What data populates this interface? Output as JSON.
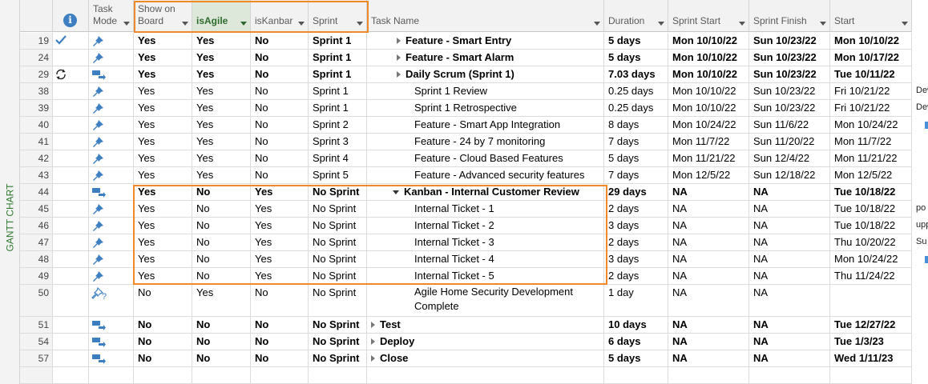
{
  "side_panel": {
    "label": "GANTT CHART"
  },
  "header": {
    "indicators": "i",
    "task_mode": "Task\nMode",
    "show_on_board": "Show on\nBoard",
    "is_agile": "isAgile",
    "is_kanban": "isKanbar",
    "sprint": "Sprint",
    "task_name": "Task Name",
    "duration": "Duration",
    "sprint_start": "Sprint Start",
    "sprint_finish": "Sprint Finish",
    "start": "Start"
  },
  "colors": {
    "highlight": "#f08a24",
    "mode_icon": "#3d7fc1",
    "header_active": "#dde7da"
  },
  "rows": [
    {
      "id": "19",
      "indicator": "check-icon",
      "mode": "manual-pin",
      "show": "Yes",
      "agile": "Yes",
      "kanban": "No",
      "sprint": "Sprint 1",
      "name": "Feature - Smart Entry",
      "level": 1,
      "toggle": "collapsed",
      "duration": "5 days",
      "sstart": "Mon 10/10/22",
      "sfinish": "Sun 10/23/22",
      "start": "Mon 10/10/22",
      "bold": true
    },
    {
      "id": "24",
      "indicator": "",
      "mode": "manual-pin",
      "show": "Yes",
      "agile": "Yes",
      "kanban": "No",
      "sprint": "Sprint 1",
      "name": "Feature - Smart Alarm",
      "level": 1,
      "toggle": "collapsed",
      "duration": "5 days",
      "sstart": "Mon 10/10/22",
      "sfinish": "Sun 10/23/22",
      "start": "Mon 10/17/22",
      "bold": true
    },
    {
      "id": "29",
      "indicator": "recurring-icon",
      "mode": "auto",
      "show": "Yes",
      "agile": "Yes",
      "kanban": "No",
      "sprint": "Sprint 1",
      "name": "Daily Scrum (Sprint 1)",
      "level": 1,
      "toggle": "collapsed",
      "duration": "7.03 days",
      "sstart": "Mon 10/10/22",
      "sfinish": "Sun 10/23/22",
      "start": "Tue 10/11/22",
      "bold": true
    },
    {
      "id": "38",
      "indicator": "",
      "mode": "manual-pin",
      "show": "Yes",
      "agile": "Yes",
      "kanban": "No",
      "sprint": "Sprint 1",
      "name": "Sprint 1 Review",
      "level": 2,
      "toggle": "",
      "duration": "0.25 days",
      "sstart": "Mon 10/10/22",
      "sfinish": "Sun 10/23/22",
      "start": "Fri 10/21/22",
      "bold": false
    },
    {
      "id": "39",
      "indicator": "",
      "mode": "manual-pin",
      "show": "Yes",
      "agile": "Yes",
      "kanban": "No",
      "sprint": "Sprint 1",
      "name": "Sprint 1 Retrospective",
      "level": 2,
      "toggle": "",
      "duration": "0.25 days",
      "sstart": "Mon 10/10/22",
      "sfinish": "Sun 10/23/22",
      "start": "Fri 10/21/22",
      "bold": false
    },
    {
      "id": "40",
      "indicator": "",
      "mode": "manual-pin",
      "show": "Yes",
      "agile": "Yes",
      "kanban": "No",
      "sprint": "Sprint 2",
      "name": "Feature - Smart App Integration",
      "level": 2,
      "toggle": "",
      "duration": "8 days",
      "sstart": "Mon 10/24/22",
      "sfinish": "Sun 11/6/22",
      "start": "Mon 10/24/22",
      "bold": false
    },
    {
      "id": "41",
      "indicator": "",
      "mode": "manual-pin",
      "show": "Yes",
      "agile": "Yes",
      "kanban": "No",
      "sprint": "Sprint 3",
      "name": "Feature - 24 by 7 monitoring",
      "level": 2,
      "toggle": "",
      "duration": "7 days",
      "sstart": "Mon 11/7/22",
      "sfinish": "Sun 11/20/22",
      "start": "Mon 11/7/22",
      "bold": false
    },
    {
      "id": "42",
      "indicator": "",
      "mode": "manual-pin",
      "show": "Yes",
      "agile": "Yes",
      "kanban": "No",
      "sprint": "Sprint 4",
      "name": "Feature - Cloud Based Features",
      "level": 2,
      "toggle": "",
      "duration": "5 days",
      "sstart": "Mon 11/21/22",
      "sfinish": "Sun 12/4/22",
      "start": "Mon 11/21/22",
      "bold": false
    },
    {
      "id": "43",
      "indicator": "",
      "mode": "manual-pin",
      "show": "Yes",
      "agile": "Yes",
      "kanban": "No",
      "sprint": "Sprint 5",
      "name": "Feature - Advanced security features",
      "level": 2,
      "toggle": "",
      "duration": "7 days",
      "sstart": "Mon 12/5/22",
      "sfinish": "Sun 12/18/22",
      "start": "Mon 12/5/22",
      "bold": false
    },
    {
      "id": "44",
      "indicator": "",
      "mode": "auto",
      "show": "Yes",
      "agile": "No",
      "kanban": "Yes",
      "sprint": "No Sprint",
      "name": "Kanban - Internal Customer Review",
      "level": 1,
      "toggle": "expanded",
      "duration": "29 days",
      "sstart": "NA",
      "sfinish": "NA",
      "start": "Tue 10/18/22",
      "bold": true
    },
    {
      "id": "45",
      "indicator": "",
      "mode": "manual-pin",
      "show": "Yes",
      "agile": "No",
      "kanban": "Yes",
      "sprint": "No Sprint",
      "name": "Internal Ticket - 1",
      "level": 2,
      "toggle": "",
      "duration": "2 days",
      "sstart": "NA",
      "sfinish": "NA",
      "start": "Tue 10/18/22",
      "bold": false
    },
    {
      "id": "46",
      "indicator": "",
      "mode": "manual-pin",
      "show": "Yes",
      "agile": "No",
      "kanban": "Yes",
      "sprint": "No Sprint",
      "name": "Internal Ticket - 2",
      "level": 2,
      "toggle": "",
      "duration": "3 days",
      "sstart": "NA",
      "sfinish": "NA",
      "start": "Tue 10/18/22",
      "bold": false
    },
    {
      "id": "47",
      "indicator": "",
      "mode": "manual-pin",
      "show": "Yes",
      "agile": "No",
      "kanban": "Yes",
      "sprint": "No Sprint",
      "name": "Internal Ticket - 3",
      "level": 2,
      "toggle": "",
      "duration": "2 days",
      "sstart": "NA",
      "sfinish": "NA",
      "start": "Thu 10/20/22",
      "bold": false
    },
    {
      "id": "48",
      "indicator": "",
      "mode": "manual-pin",
      "show": "Yes",
      "agile": "No",
      "kanban": "Yes",
      "sprint": "No Sprint",
      "name": "Internal Ticket - 4",
      "level": 2,
      "toggle": "",
      "duration": "3 days",
      "sstart": "NA",
      "sfinish": "NA",
      "start": "Mon 10/24/22",
      "bold": false
    },
    {
      "id": "49",
      "indicator": "",
      "mode": "manual-pin",
      "show": "Yes",
      "agile": "No",
      "kanban": "Yes",
      "sprint": "No Sprint",
      "name": "Internal Ticket - 5",
      "level": 2,
      "toggle": "",
      "duration": "2 days",
      "sstart": "NA",
      "sfinish": "NA",
      "start": "Thu 11/24/22",
      "bold": false
    },
    {
      "id": "50",
      "indicator": "",
      "mode": "manual-question",
      "show": "No",
      "agile": "Yes",
      "kanban": "No",
      "sprint": "No Sprint",
      "name": "Agile Home Security Development Complete",
      "level": 2,
      "toggle": "",
      "duration": "1 day",
      "sstart": "NA",
      "sfinish": "NA",
      "start": "",
      "bold": false,
      "tall": true
    },
    {
      "id": "51",
      "indicator": "",
      "mode": "auto",
      "show": "No",
      "agile": "No",
      "kanban": "No",
      "sprint": "No Sprint",
      "name": "Test",
      "level": 0,
      "toggle": "collapsed",
      "duration": "10 days",
      "sstart": "NA",
      "sfinish": "NA",
      "start": "Tue 12/27/22",
      "bold": true
    },
    {
      "id": "54",
      "indicator": "",
      "mode": "auto",
      "show": "No",
      "agile": "No",
      "kanban": "No",
      "sprint": "No Sprint",
      "name": "Deploy",
      "level": 0,
      "toggle": "collapsed",
      "duration": "6 days",
      "sstart": "NA",
      "sfinish": "NA",
      "start": "Tue 1/3/23",
      "bold": true
    },
    {
      "id": "57",
      "indicator": "",
      "mode": "auto",
      "show": "No",
      "agile": "No",
      "kanban": "No",
      "sprint": "No Sprint",
      "name": "Close",
      "level": 0,
      "toggle": "collapsed",
      "duration": "5 days",
      "sstart": "NA",
      "sfinish": "NA",
      "start": "Wed 1/11/23",
      "bold": true
    }
  ],
  "gantt_edge": [
    {
      "text": "Dev",
      "row": "38"
    },
    {
      "text": "Dev",
      "row": "39"
    },
    {
      "text": "po",
      "row": "45"
    },
    {
      "text": "upp",
      "row": "46"
    },
    {
      "text": "Su",
      "row": "47"
    }
  ]
}
